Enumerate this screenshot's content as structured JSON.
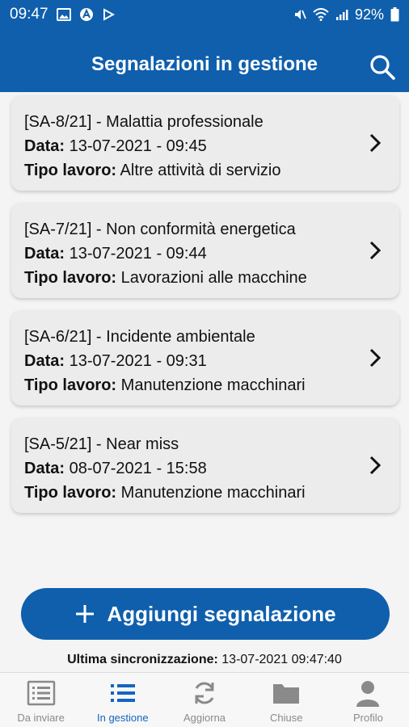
{
  "status_bar": {
    "time": "09:47",
    "battery": "92%",
    "left_icons": [
      "image-icon",
      "app-icon",
      "play-icon"
    ],
    "right_icons": [
      "mute-icon",
      "wifi-icon",
      "signal-icon",
      "battery-icon"
    ]
  },
  "header": {
    "title": "Segnalazioni in gestione",
    "search_icon": "search-icon"
  },
  "labels": {
    "data": "Data:",
    "tipo_lavoro": "Tipo lavoro:"
  },
  "reports": [
    {
      "title": "[SA-8/21] - Malattia professionale",
      "date": "13-07-2021 - 09:45",
      "work_type": "Altre attività di servizio"
    },
    {
      "title": "[SA-7/21] - Non conformità energetica",
      "date": "13-07-2021 - 09:44",
      "work_type": "Lavorazioni alle macchine"
    },
    {
      "title": "[SA-6/21] - Incidente ambientale",
      "date": "13-07-2021 - 09:31",
      "work_type": "Manutenzione macchinari"
    },
    {
      "title": "[SA-5/21] - Near miss",
      "date": "08-07-2021 - 15:58",
      "work_type": "Manutenzione macchinari"
    }
  ],
  "add_button": {
    "label": "Aggiungi segnalazione",
    "icon": "plus-icon"
  },
  "sync": {
    "label": "Ultima sincronizzazione:",
    "value": "13-07-2021 09:47:40"
  },
  "nav": [
    {
      "label": "Da inviare",
      "icon": "list-box-icon",
      "active": false
    },
    {
      "label": "In gestione",
      "icon": "list-icon",
      "active": true
    },
    {
      "label": "Aggiorna",
      "icon": "refresh-icon",
      "active": false
    },
    {
      "label": "Chiuse",
      "icon": "folder-icon",
      "active": false
    },
    {
      "label": "Profilo",
      "icon": "person-icon",
      "active": false
    }
  ],
  "colors": {
    "primary": "#0f5fad",
    "active_nav": "#1565c0",
    "card_bg": "#ececec"
  }
}
